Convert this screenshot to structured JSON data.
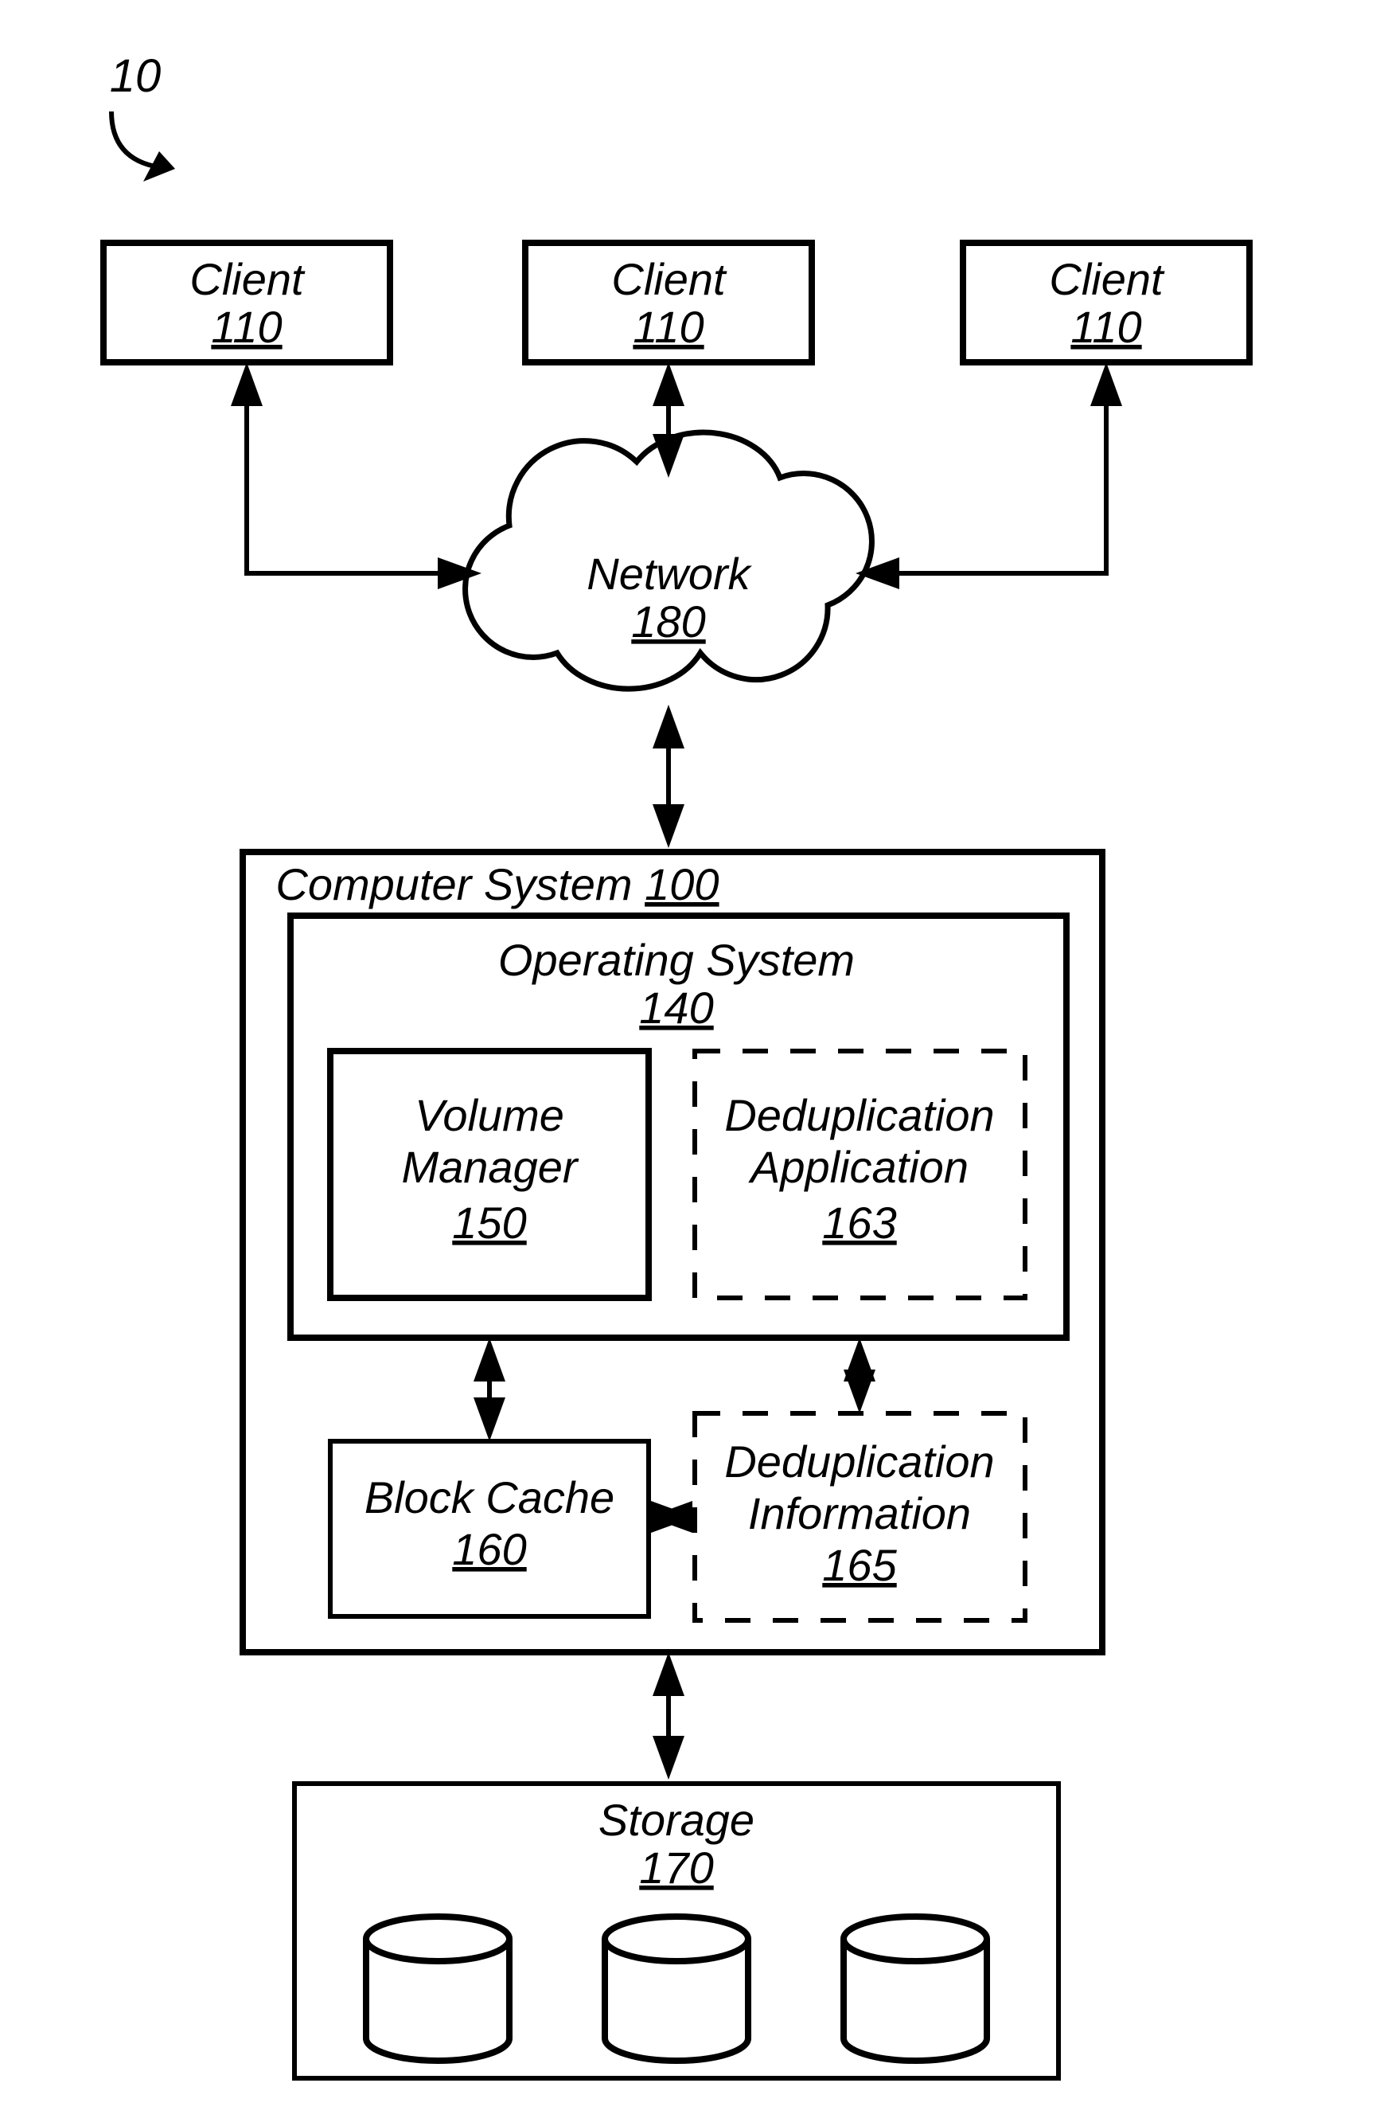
{
  "figure_id": "10",
  "clients": [
    {
      "label": "Client",
      "num": "110"
    },
    {
      "label": "Client",
      "num": "110"
    },
    {
      "label": "Client",
      "num": "110"
    }
  ],
  "network": {
    "label": "Network",
    "num": "180"
  },
  "cs": {
    "label": "Computer System",
    "num": "100"
  },
  "os": {
    "label": "Operating System",
    "num": "140"
  },
  "vm": {
    "label1": "Volume",
    "label2": "Manager",
    "num": "150"
  },
  "dapp": {
    "label1": "Deduplication",
    "label2": "Application",
    "num": "163"
  },
  "bc": {
    "label1": "Block Cache",
    "num": "160"
  },
  "dinfo": {
    "label1": "Deduplication",
    "label2": "Information",
    "num": "165"
  },
  "storage": {
    "label": "Storage",
    "num": "170"
  }
}
